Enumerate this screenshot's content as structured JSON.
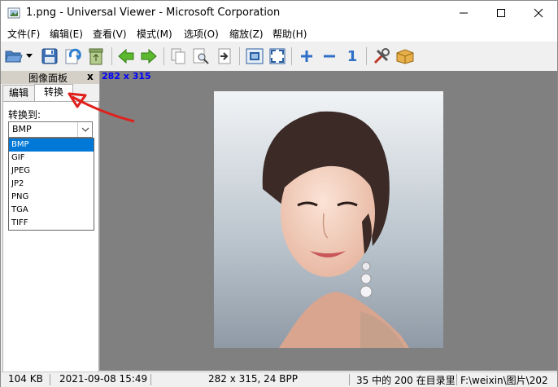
{
  "window": {
    "title": "1.png - Universal Viewer - Microsoft Corporation"
  },
  "menu": [
    "文件(F)",
    "编辑(E)",
    "查看(V)",
    "模式(M)",
    "选项(O)",
    "缩放(Z)",
    "帮助(H)"
  ],
  "toolbar": {
    "buttons": [
      "open-icon",
      "dropdown-arrow-icon",
      "save-icon",
      "reload-icon",
      "recycle-icon",
      "back-arrow-icon",
      "forward-arrow-icon",
      "copy-icon",
      "find-icon",
      "goto-icon",
      "fit-window-icon",
      "fullscreen-icon",
      "zoom-in-icon",
      "zoom-out-icon",
      "zoom-actual-icon",
      "tools-icon",
      "package-icon"
    ],
    "zoom_actual_label": "1"
  },
  "panel": {
    "title": "图像面板",
    "close": "x",
    "tabs": [
      "编辑",
      "转换"
    ],
    "active_tab": "转换",
    "convert_label": "转换到:",
    "format_selected": "BMP",
    "formats": [
      "BMP",
      "GIF",
      "JPEG",
      "JP2",
      "PNG",
      "TGA",
      "TIFF"
    ]
  },
  "viewer": {
    "dimensions": "282 x 315"
  },
  "status": {
    "size": "104 KB",
    "date": "2021-09-08 15:49",
    "info": "282 x 315, 24 BPP",
    "position": "35 中的 200 在目录里",
    "path": "F:\\weixin\\图片\\202"
  },
  "colors": {
    "selection": "#0078d7",
    "viewer_bg": "#808080",
    "dims_text": "#0000ff",
    "annotation": "#e0201c"
  }
}
